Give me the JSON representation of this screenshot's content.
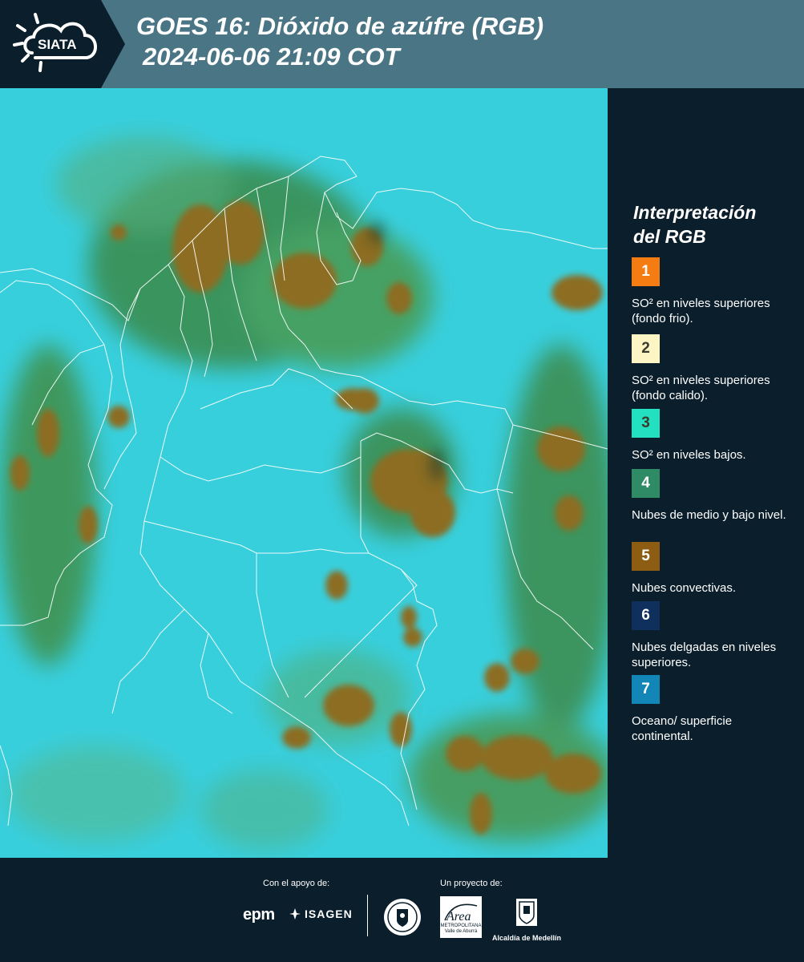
{
  "header": {
    "logo_text": "SIATA",
    "title_line1": "GOES 16: Dióxido de azúfre (RGB)",
    "title_line2": "2024-06-06 21:09 COT"
  },
  "legend": {
    "title_line1": "Interpretación",
    "title_line2": "del RGB",
    "items": [
      {
        "number": "1",
        "color": "#f57c12",
        "text": "SO² en niveles superiores (fondo frio)."
      },
      {
        "number": "2",
        "color": "#fdf5c4",
        "text": "SO² en niveles superiores (fondo calido)."
      },
      {
        "number": "3",
        "color": "#22e0c0",
        "text": "SO² en niveles bajos."
      },
      {
        "number": "4",
        "color": "#2f8a66",
        "text": "Nubes de medio y bajo nivel."
      },
      {
        "number": "5",
        "color": "#8c5d12",
        "text": "Nubes convectivas."
      },
      {
        "number": "6",
        "color": "#0f2f5c",
        "text": "Nubes delgadas en niveles superiores."
      },
      {
        "number": "7",
        "color": "#1386b8",
        "text": "Oceano/ superficie continental."
      }
    ]
  },
  "footer": {
    "support_label": "Con el apoyo de:",
    "project_label": "Un proyecto de:",
    "sponsor1": "epm",
    "sponsor2": "ISAGEN",
    "area_name": "Área",
    "area_caption": "METROPOLITANA Valle de Aburrá",
    "alcaldia": "Alcaldía de Medellín"
  },
  "colors": {
    "header_bg": "#4a7585",
    "panel_bg": "#0b1e2b",
    "ocean": "#39d0df",
    "convective": "#8c6b1c",
    "land_green": "#3c8c4a"
  }
}
